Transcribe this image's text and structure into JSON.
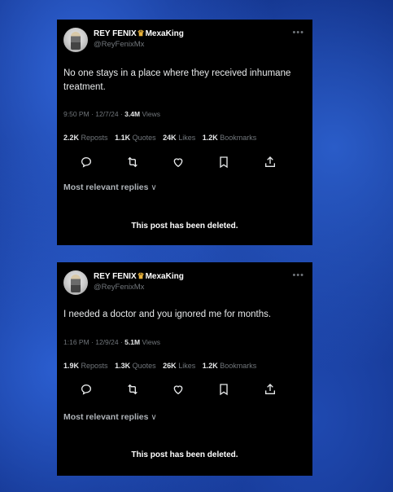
{
  "posts": [
    {
      "display_name": "REY FENIX",
      "badge_text": "MexaKing",
      "handle": "@ReyFenixMx",
      "text": "No one stays in a place where they received inhumane treatment.",
      "time": "9:50 PM",
      "date": "12/7/24",
      "views": "3.4M",
      "views_label": "Views",
      "reposts": "2.2K",
      "reposts_label": "Reposts",
      "quotes": "1.1K",
      "quotes_label": "Quotes",
      "likes": "24K",
      "likes_label": "Likes",
      "bookmarks": "1.2K",
      "bookmarks_label": "Bookmarks",
      "replies_label": "Most relevant replies",
      "deleted_notice": "This post has been deleted."
    },
    {
      "display_name": "REY FENIX",
      "badge_text": "MexaKing",
      "handle": "@ReyFenixMx",
      "text": "I needed a doctor and you ignored me for months.",
      "time": "1:16 PM",
      "date": "12/9/24",
      "views": "5.1M",
      "views_label": "Views",
      "reposts": "1.9K",
      "reposts_label": "Reposts",
      "quotes": "1.3K",
      "quotes_label": "Quotes",
      "likes": "26K",
      "likes_label": "Likes",
      "bookmarks": "1.2K",
      "bookmarks_label": "Bookmarks",
      "replies_label": "Most relevant replies",
      "deleted_notice": "This post has been deleted."
    }
  ],
  "icons": [
    "reply-icon",
    "repost-icon",
    "like-icon",
    "bookmark-icon",
    "share-icon",
    "more-icon",
    "crown-icon",
    "chevron-down-icon"
  ],
  "colors": {
    "card_bg": "#000000",
    "muted": "#71767b",
    "text": "#e7e9ea",
    "background": "#1a3f9e"
  }
}
